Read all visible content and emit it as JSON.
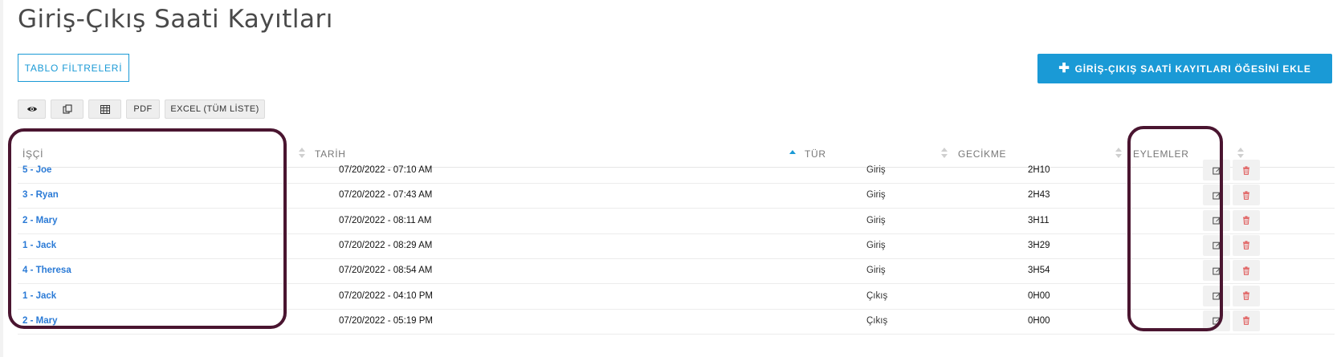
{
  "page": {
    "title": "Giriş-Çıkış Saati Kayıtları"
  },
  "toolbar": {
    "filters_label": "TABLO FİLTRELERİ",
    "add_icon": "plus-icon",
    "add_label": "GİRİŞ-ÇIKIŞ SAATİ KAYITLARI ÖĞESİNİ EKLE",
    "view_icon": "eye-icon",
    "copy_icon": "copy-icon",
    "csv_icon": "table-icon",
    "pdf_label": "PDF",
    "excel_label": "EXCEL (TÜM LİSTE)"
  },
  "table": {
    "headers": {
      "worker": "İŞÇİ",
      "date": "TARİH",
      "type": "TÜR",
      "delay": "GECİKME",
      "actions": "EYLEMLER"
    },
    "sorted_column": "date",
    "sort_direction": "asc",
    "rows": [
      {
        "worker": "5 - Joe",
        "date": "07/20/2022 - 07:10 AM",
        "type": "Giriş",
        "delay": "2H10"
      },
      {
        "worker": "3 - Ryan",
        "date": "07/20/2022 - 07:43 AM",
        "type": "Giriş",
        "delay": "2H43"
      },
      {
        "worker": "2 - Mary",
        "date": "07/20/2022 - 08:11 AM",
        "type": "Giriş",
        "delay": "3H11"
      },
      {
        "worker": "1 - Jack",
        "date": "07/20/2022 - 08:29 AM",
        "type": "Giriş",
        "delay": "3H29"
      },
      {
        "worker": "4 - Theresa",
        "date": "07/20/2022 - 08:54 AM",
        "type": "Giriş",
        "delay": "3H54"
      },
      {
        "worker": "1 - Jack",
        "date": "07/20/2022 - 04:10 PM",
        "type": "Çıkış",
        "delay": "0H00"
      },
      {
        "worker": "2 - Mary",
        "date": "07/20/2022 - 05:19 PM",
        "type": "Çıkış",
        "delay": "0H00"
      }
    ],
    "row_actions": {
      "edit_icon": "edit-icon",
      "delete_icon": "trash-icon"
    }
  },
  "colors": {
    "accent": "#1a9ad6",
    "link": "#2a7ad6",
    "delete": "#e05a5a",
    "highlight_border": "#4a1530"
  }
}
